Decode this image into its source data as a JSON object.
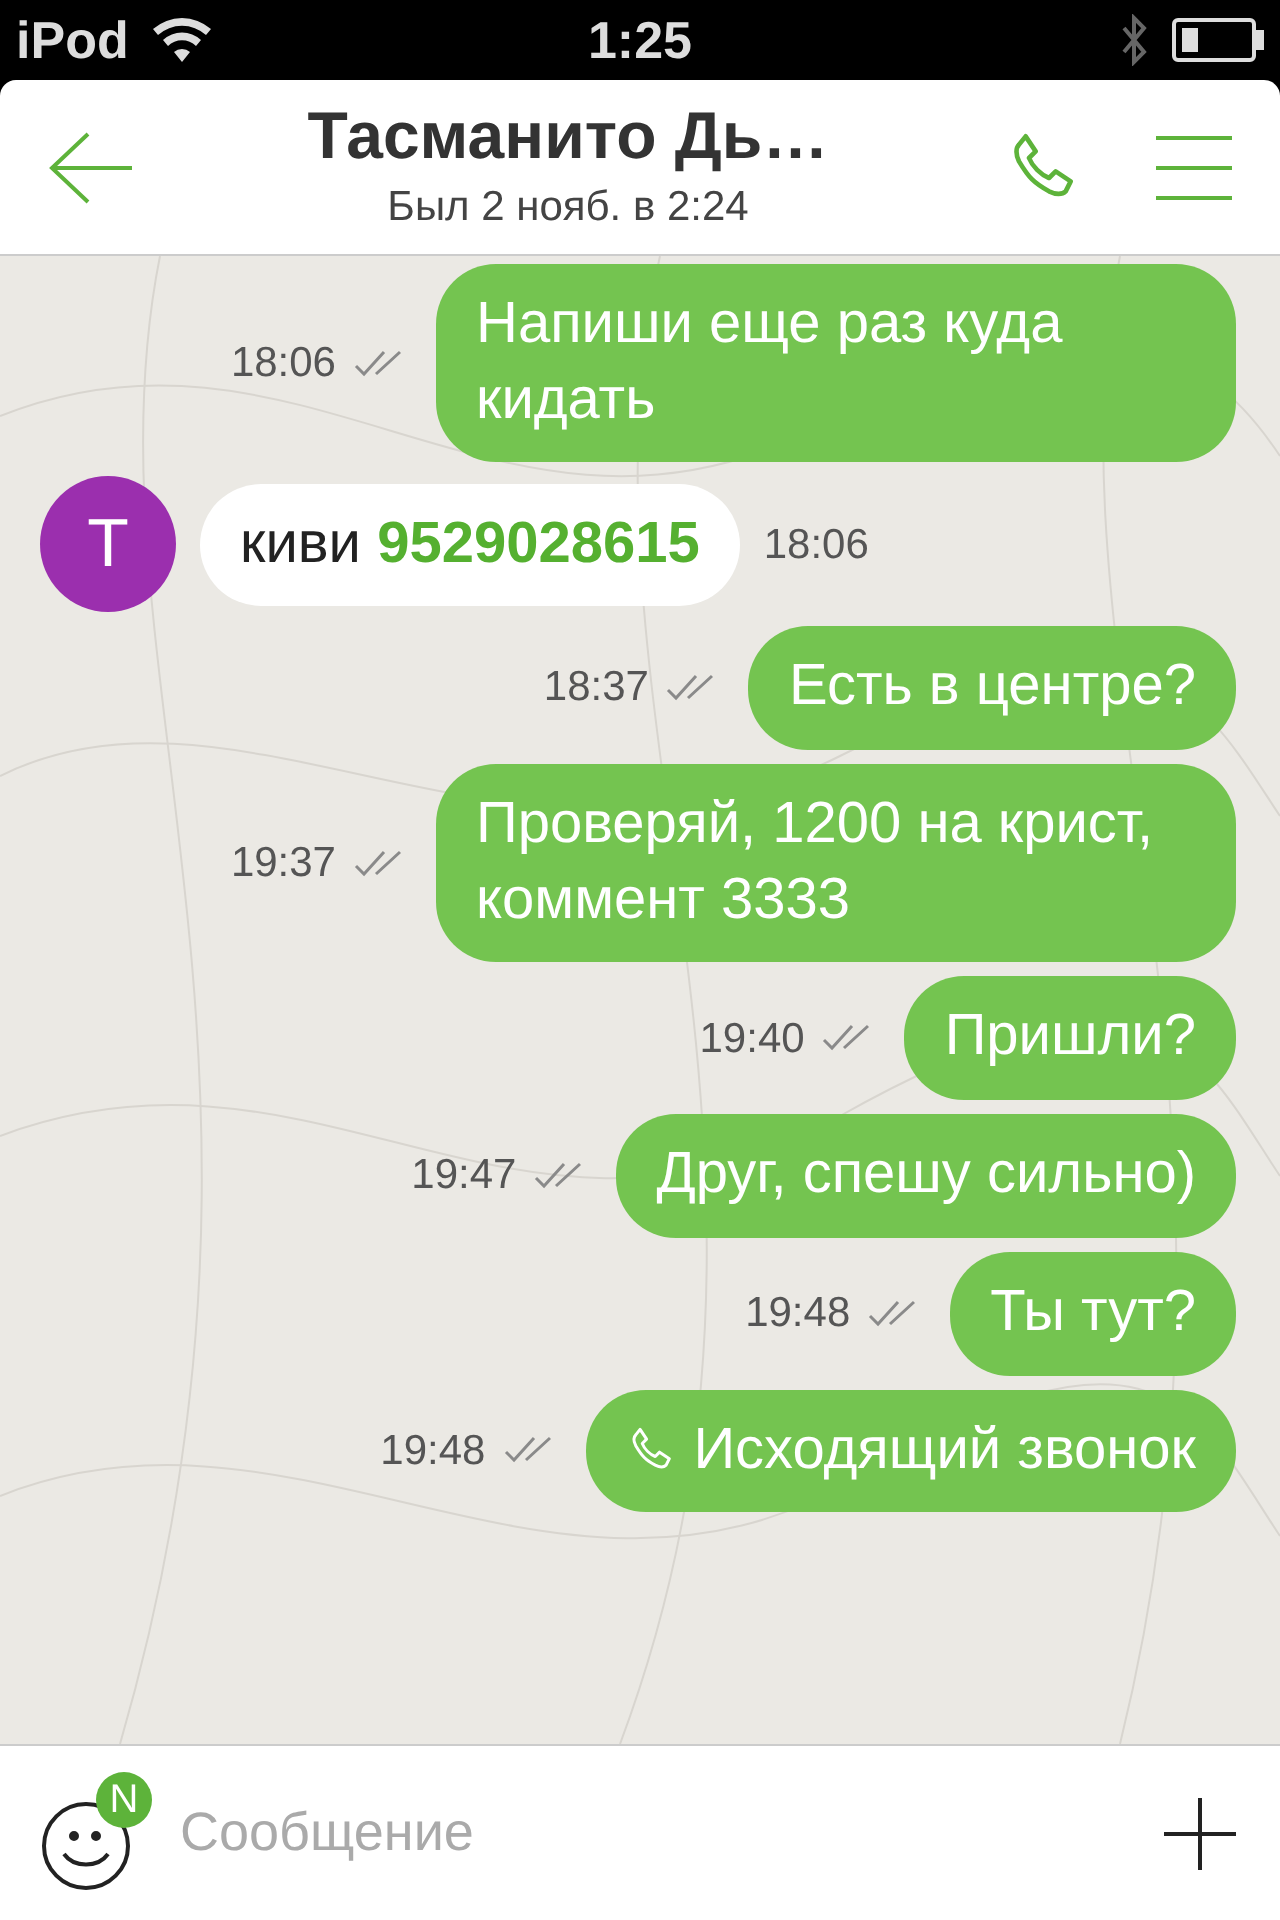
{
  "status_bar": {
    "carrier": "iPod",
    "time": "1:25"
  },
  "header": {
    "title": "Тасманито Дь…",
    "subtitle": "Был 2 нояб. в 2:24"
  },
  "messages": [
    {
      "kind": "out",
      "text": "Напиши еще раз куда кидать",
      "time": "18:06"
    },
    {
      "kind": "in",
      "avatar": "T",
      "color": "#9b2fae",
      "text": "киви **9529028615**",
      "time": "18:06"
    },
    {
      "kind": "out",
      "text": "Есть в центре?",
      "time": "18:37"
    },
    {
      "kind": "out",
      "text": "Проверяй, 1200 на крист, коммент 3333",
      "time": "19:37"
    },
    {
      "kind": "out",
      "text": "Пришли?",
      "time": "19:40"
    },
    {
      "kind": "out",
      "text": "Друг, спешу сильно)",
      "time": "19:47"
    },
    {
      "kind": "out",
      "text": "Ты тут?",
      "time": "19:48"
    },
    {
      "kind": "call",
      "text": "Исходящий звонок",
      "time": "19:48"
    }
  ],
  "composer": {
    "placeholder": "Сообщение",
    "badge": "N"
  }
}
